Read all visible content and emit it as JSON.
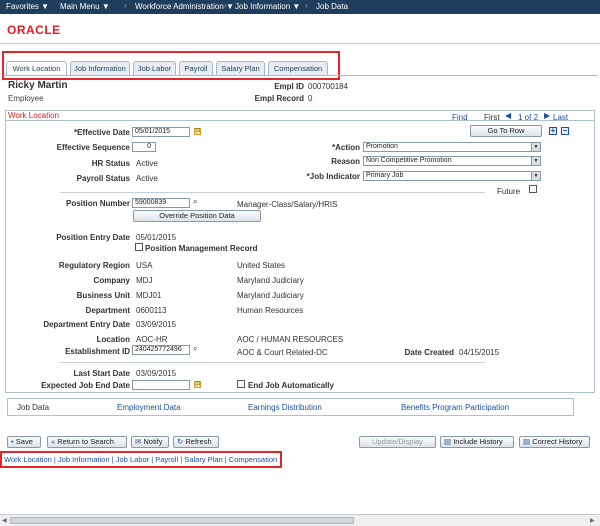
{
  "topnav": {
    "favorites": "Favorites",
    "main_menu": "Main Menu",
    "workforce": "Workforce Administration",
    "job_information": "Job Information",
    "job_data": "Job Data"
  },
  "brand": {
    "logo": "ORACLE"
  },
  "tabs": [
    {
      "label": "Work Location",
      "active": true
    },
    {
      "label": "Job Information"
    },
    {
      "label": "Job Labor"
    },
    {
      "label": "Payroll"
    },
    {
      "label": "Salary Plan"
    },
    {
      "label": "Compensation"
    }
  ],
  "employee": {
    "name": "Ricky Martin",
    "type": "Employee",
    "empl_id_label": "Empl ID",
    "empl_id": "000700184",
    "empl_record_label": "Empl Record",
    "empl_record": "0"
  },
  "section": {
    "title": "Work Location",
    "find": "Find",
    "first": "First",
    "nav_count": "1 of 2",
    "last": "Last",
    "go_to_row": "Go To Row"
  },
  "fields": {
    "effective_date_label": "*Effective Date",
    "effective_date": "05/01/2015",
    "effective_seq_label": "Effective Sequence",
    "effective_seq": "0",
    "hr_status_label": "HR Status",
    "hr_status": "Active",
    "payroll_status_label": "Payroll Status",
    "payroll_status": "Active",
    "action_label": "*Action",
    "action": "Promotion",
    "reason_label": "Reason",
    "reason": "Non Competitive Promotion",
    "job_indicator_label": "*Job Indicator",
    "job_indicator": "Primary Job",
    "future_label": "Future",
    "position_number_label": "Position Number",
    "position_number": "59000839",
    "position_desc": "Manager-Class/Salary/HRIS",
    "override_button": "Override Position Data",
    "position_entry_label": "Position Entry Date",
    "position_entry": "05/01/2015",
    "position_mgmt_label": "Position Management Record",
    "regulatory_label": "Regulatory Region",
    "regulatory": "USA",
    "regulatory_desc": "United States",
    "company_label": "Company",
    "company": "MDJ",
    "company_desc": "Maryland Judiciary",
    "business_unit_label": "Business Unit",
    "business_unit": "MDJ01",
    "business_unit_desc": "Maryland Judiciary",
    "department_label": "Department",
    "department": "0600113",
    "department_desc": "Human Resources",
    "dept_entry_label": "Department Entry Date",
    "dept_entry": "03/09/2015",
    "location_label": "Location",
    "location": "AOC-HR",
    "location_desc": "AOC / HUMAN RESOURCES",
    "establishment_label": "Establishment ID",
    "establishment": "240425772496",
    "establishment_desc": "AOC & Court Related-DC",
    "date_created_label": "Date Created",
    "date_created": "04/15/2015",
    "last_start_label": "Last Start Date",
    "last_start": "03/09/2015",
    "expected_end_label": "Expected Job End Date",
    "expected_end": "",
    "end_auto_label": "End Job Automatically"
  },
  "subnav": {
    "job_data": "Job Data",
    "employment_data": "Employment Data",
    "earnings": "Earnings Distribution",
    "benefits": "Benefits Program Participation"
  },
  "buttons": {
    "save": "Save",
    "return": "Return to Search",
    "notify": "Notify",
    "refresh": "Refresh",
    "update_display": "Update/Display",
    "include_history": "Include History",
    "correct_history": "Correct History"
  },
  "bottom_links": {
    "work_location": "Work Location",
    "job_information": "Job Information",
    "job_labor": "Job Labor",
    "payroll": "Payroll",
    "salary_plan": "Salary Plan",
    "compensation": "Compensation",
    "separator": " | "
  }
}
